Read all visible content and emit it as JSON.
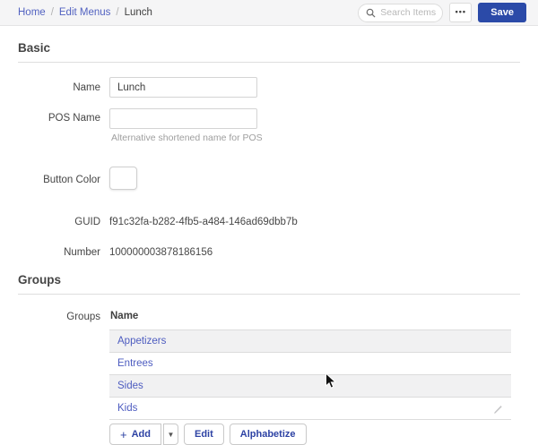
{
  "header": {
    "breadcrumb": {
      "separator": "/",
      "items": [
        {
          "label": "Home"
        },
        {
          "label": "Edit Menus"
        },
        {
          "label": "Lunch"
        }
      ]
    },
    "search": {
      "placeholder": "Search Items"
    },
    "more_button_label": "•••",
    "save_button_label": "Save"
  },
  "basic": {
    "title": "Basic",
    "name_label": "Name",
    "name_value": "Lunch",
    "pos_name_label": "POS Name",
    "pos_name_value": "",
    "pos_name_helper": "Alternative shortened name for POS",
    "button_color_label": "Button Color",
    "guid_label": "GUID",
    "guid_value": "f91c32fa-b282-4fb5-a484-146ad69dbb7b",
    "number_label": "Number",
    "number_value": "100000003878186156"
  },
  "groups": {
    "title": "Groups",
    "row_label": "Groups",
    "table_header": "Name",
    "rows": [
      "Appetizers",
      "Entrees",
      "Sides",
      "Kids"
    ],
    "actions": {
      "add_icon": "+",
      "add_label": "Add",
      "dropdown_caret": "▼",
      "edit_label": "Edit",
      "alphabetize_label": "Alphabetize"
    }
  },
  "colors": {
    "accent_blue": "#2b4aa8",
    "link_blue": "#4d5cc0",
    "row_stripe_gray": "#f1f1f2",
    "topbar_gray": "#f5f5f6"
  }
}
